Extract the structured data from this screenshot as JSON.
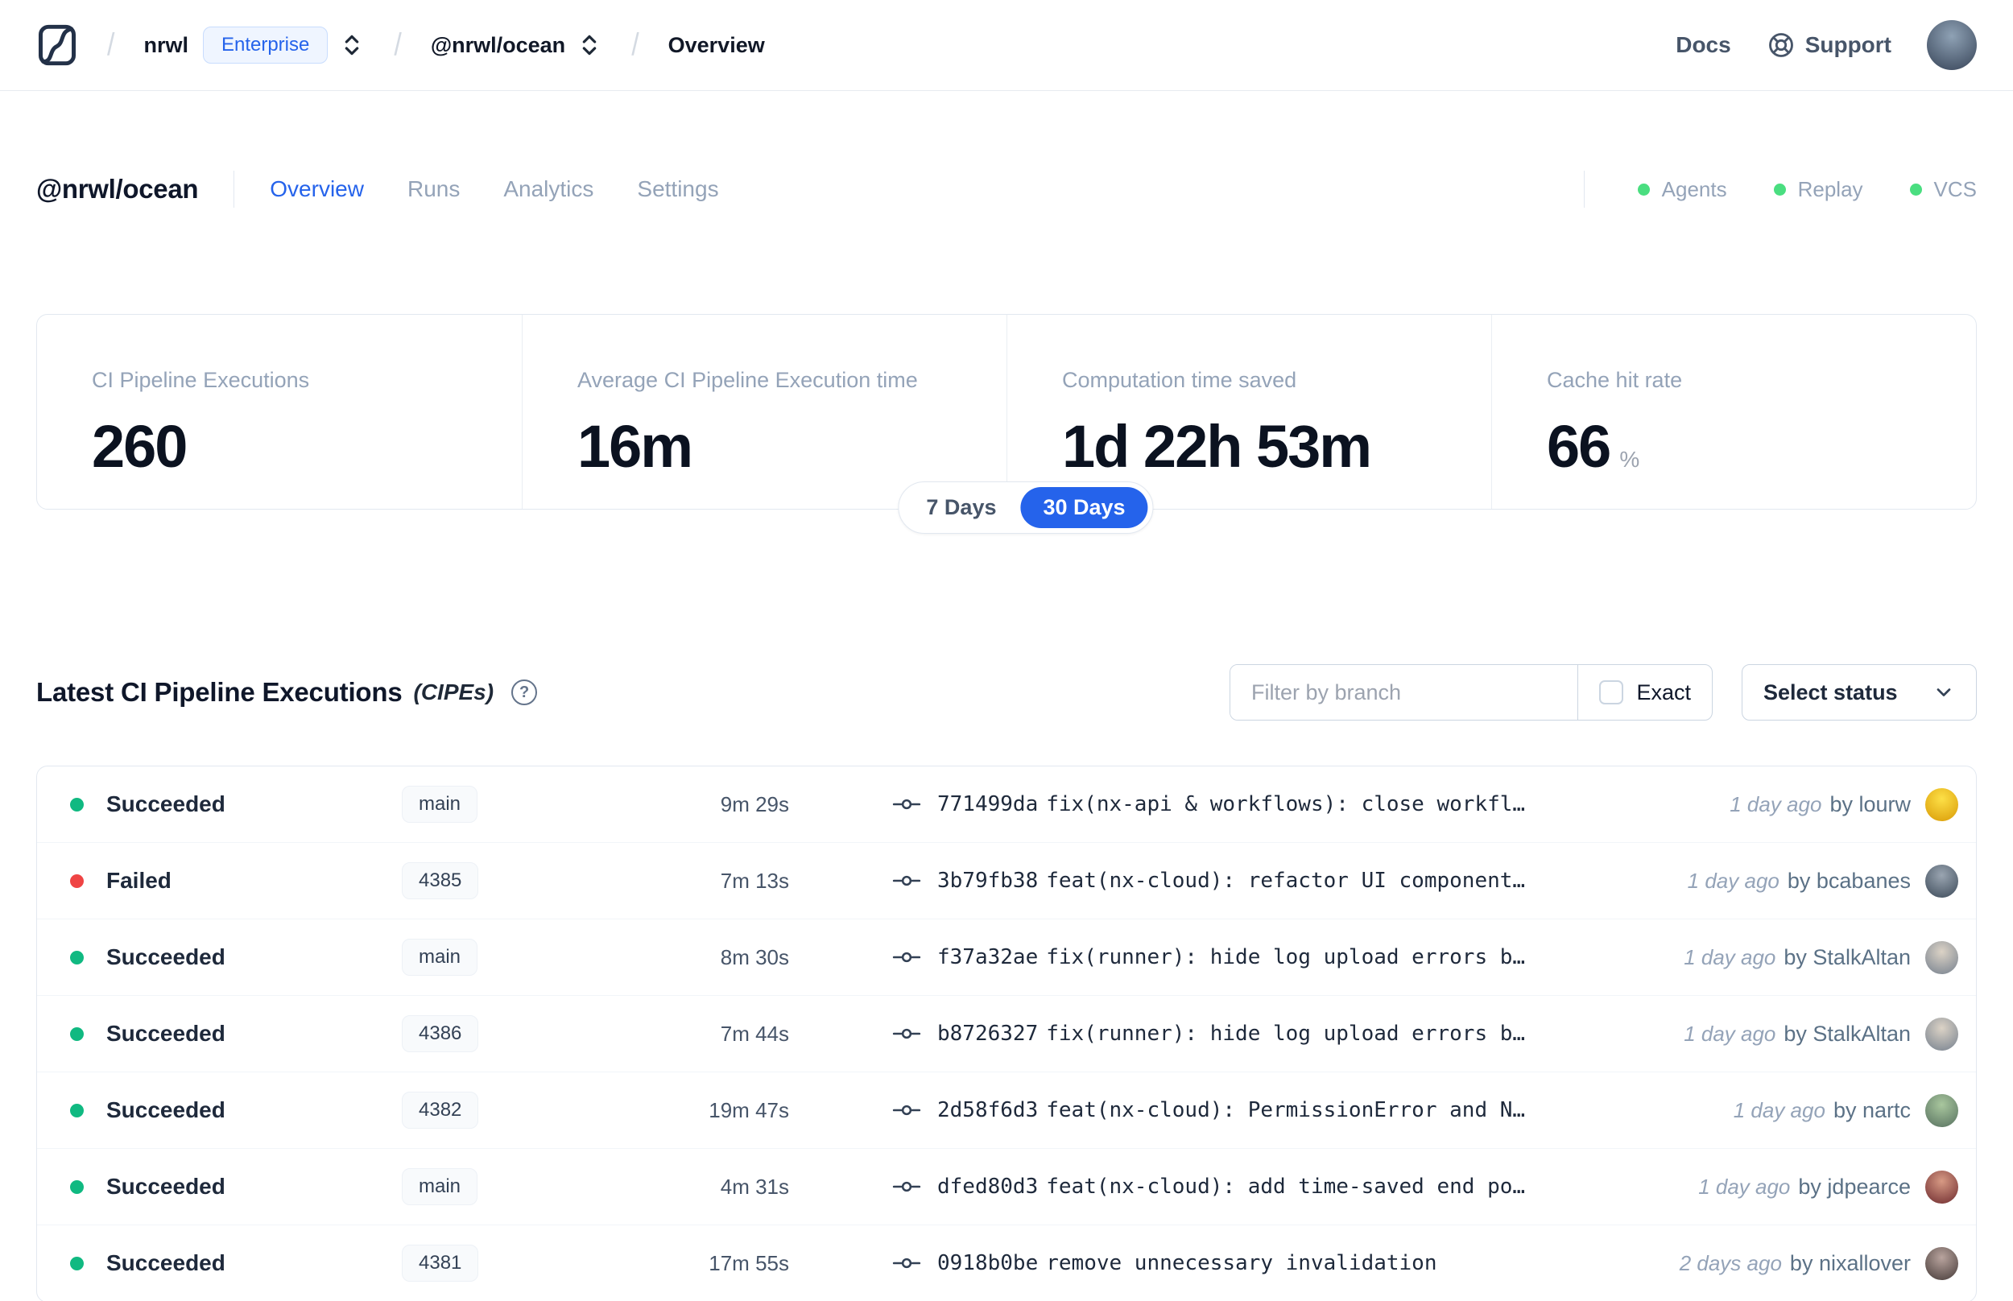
{
  "nav": {
    "separator": "/",
    "org": "nrwl",
    "org_badge": "Enterprise",
    "workspace": "@nrwl/ocean",
    "page": "Overview",
    "docs_label": "Docs",
    "support_label": "Support",
    "user_avatar": {
      "c1": "#8fa2b5",
      "c2": "#364357"
    }
  },
  "header": {
    "title": "@nrwl/ocean",
    "tabs": [
      {
        "label": "Overview",
        "state": "active"
      },
      {
        "label": "Runs",
        "state": ""
      },
      {
        "label": "Analytics",
        "state": ""
      },
      {
        "label": "Settings",
        "state": ""
      }
    ],
    "legend": [
      {
        "label": "Agents"
      },
      {
        "label": "Replay"
      },
      {
        "label": "VCS"
      }
    ]
  },
  "stats": {
    "cards": [
      {
        "label": "CI Pipeline Executions",
        "value": "260",
        "suffix": ""
      },
      {
        "label": "Average CI Pipeline Execution time",
        "value": "16m",
        "suffix": ""
      },
      {
        "label": "Computation time saved",
        "value": "1d 22h 53m",
        "suffix": ""
      },
      {
        "label": "Cache hit rate",
        "value": "66",
        "suffix": "%"
      }
    ],
    "range": {
      "options": [
        {
          "label": "7 Days",
          "state": ""
        },
        {
          "label": "30 Days",
          "state": "selected"
        }
      ],
      "selected": "30 Days"
    }
  },
  "cipes": {
    "title": "Latest CI Pipeline Executions",
    "title_suffix": "(CIPEs)",
    "help_glyph": "?",
    "filter_placeholder": "Filter by branch",
    "filter_value": "",
    "exact_label": "Exact",
    "exact_checked": false,
    "status_dropdown_label": "Select status",
    "rows": [
      {
        "status": "Succeeded",
        "status_class": "succeeded",
        "branch": "main",
        "duration": "9m 29s",
        "hash": "771499da",
        "message": "fix(nx-api & workflows): close workfl…",
        "time_ago": "1 day ago",
        "author": "by lourw",
        "avatar": {
          "c1": "#fde047",
          "c2": "#d99a06"
        }
      },
      {
        "status": "Failed",
        "status_class": "failed",
        "branch": "4385",
        "duration": "7m 13s",
        "hash": "3b79fb38",
        "message": "feat(nx-cloud): refactor UI component…",
        "time_ago": "1 day ago",
        "author": "by bcabanes",
        "avatar": {
          "c1": "#9aa5b1",
          "c2": "#3c4a59"
        }
      },
      {
        "status": "Succeeded",
        "status_class": "succeeded",
        "branch": "main",
        "duration": "8m 30s",
        "hash": "f37a32ae",
        "message": "fix(runner): hide log upload errors b…",
        "time_ago": "1 day ago",
        "author": "by StalkAltan",
        "avatar": {
          "c1": "#dcd3c6",
          "c2": "#75808e"
        }
      },
      {
        "status": "Succeeded",
        "status_class": "succeeded",
        "branch": "4386",
        "duration": "7m 44s",
        "hash": "b8726327",
        "message": "fix(runner): hide log upload errors b…",
        "time_ago": "1 day ago",
        "author": "by StalkAltan",
        "avatar": {
          "c1": "#dcd3c6",
          "c2": "#75808e"
        }
      },
      {
        "status": "Succeeded",
        "status_class": "succeeded",
        "branch": "4382",
        "duration": "19m 47s",
        "hash": "2d58f6d3",
        "message": "feat(nx-cloud): PermissionError and N…",
        "time_ago": "1 day ago",
        "author": "by nartc",
        "avatar": {
          "c1": "#a9c79e",
          "c2": "#56705f"
        }
      },
      {
        "status": "Succeeded",
        "status_class": "succeeded",
        "branch": "main",
        "duration": "4m 31s",
        "hash": "dfed80d3",
        "message": "feat(nx-cloud): add time-saved end po…",
        "time_ago": "1 day ago",
        "author": "by jdpearce",
        "avatar": {
          "c1": "#d79a84",
          "c2": "#6e2a2e"
        }
      },
      {
        "status": "Succeeded",
        "status_class": "succeeded",
        "branch": "4381",
        "duration": "17m 55s",
        "hash": "0918b0be",
        "message": "remove unnecessary invalidation",
        "time_ago": "2 days ago",
        "author": "by nixallover",
        "avatar": {
          "c1": "#b9a49e",
          "c2": "#453a38"
        }
      }
    ]
  },
  "colors": {
    "accent": "#2563eb",
    "succeeded": "#10b981",
    "failed": "#ef4444",
    "legend_ok": "#4ade80",
    "border": "#e2e8f0"
  }
}
